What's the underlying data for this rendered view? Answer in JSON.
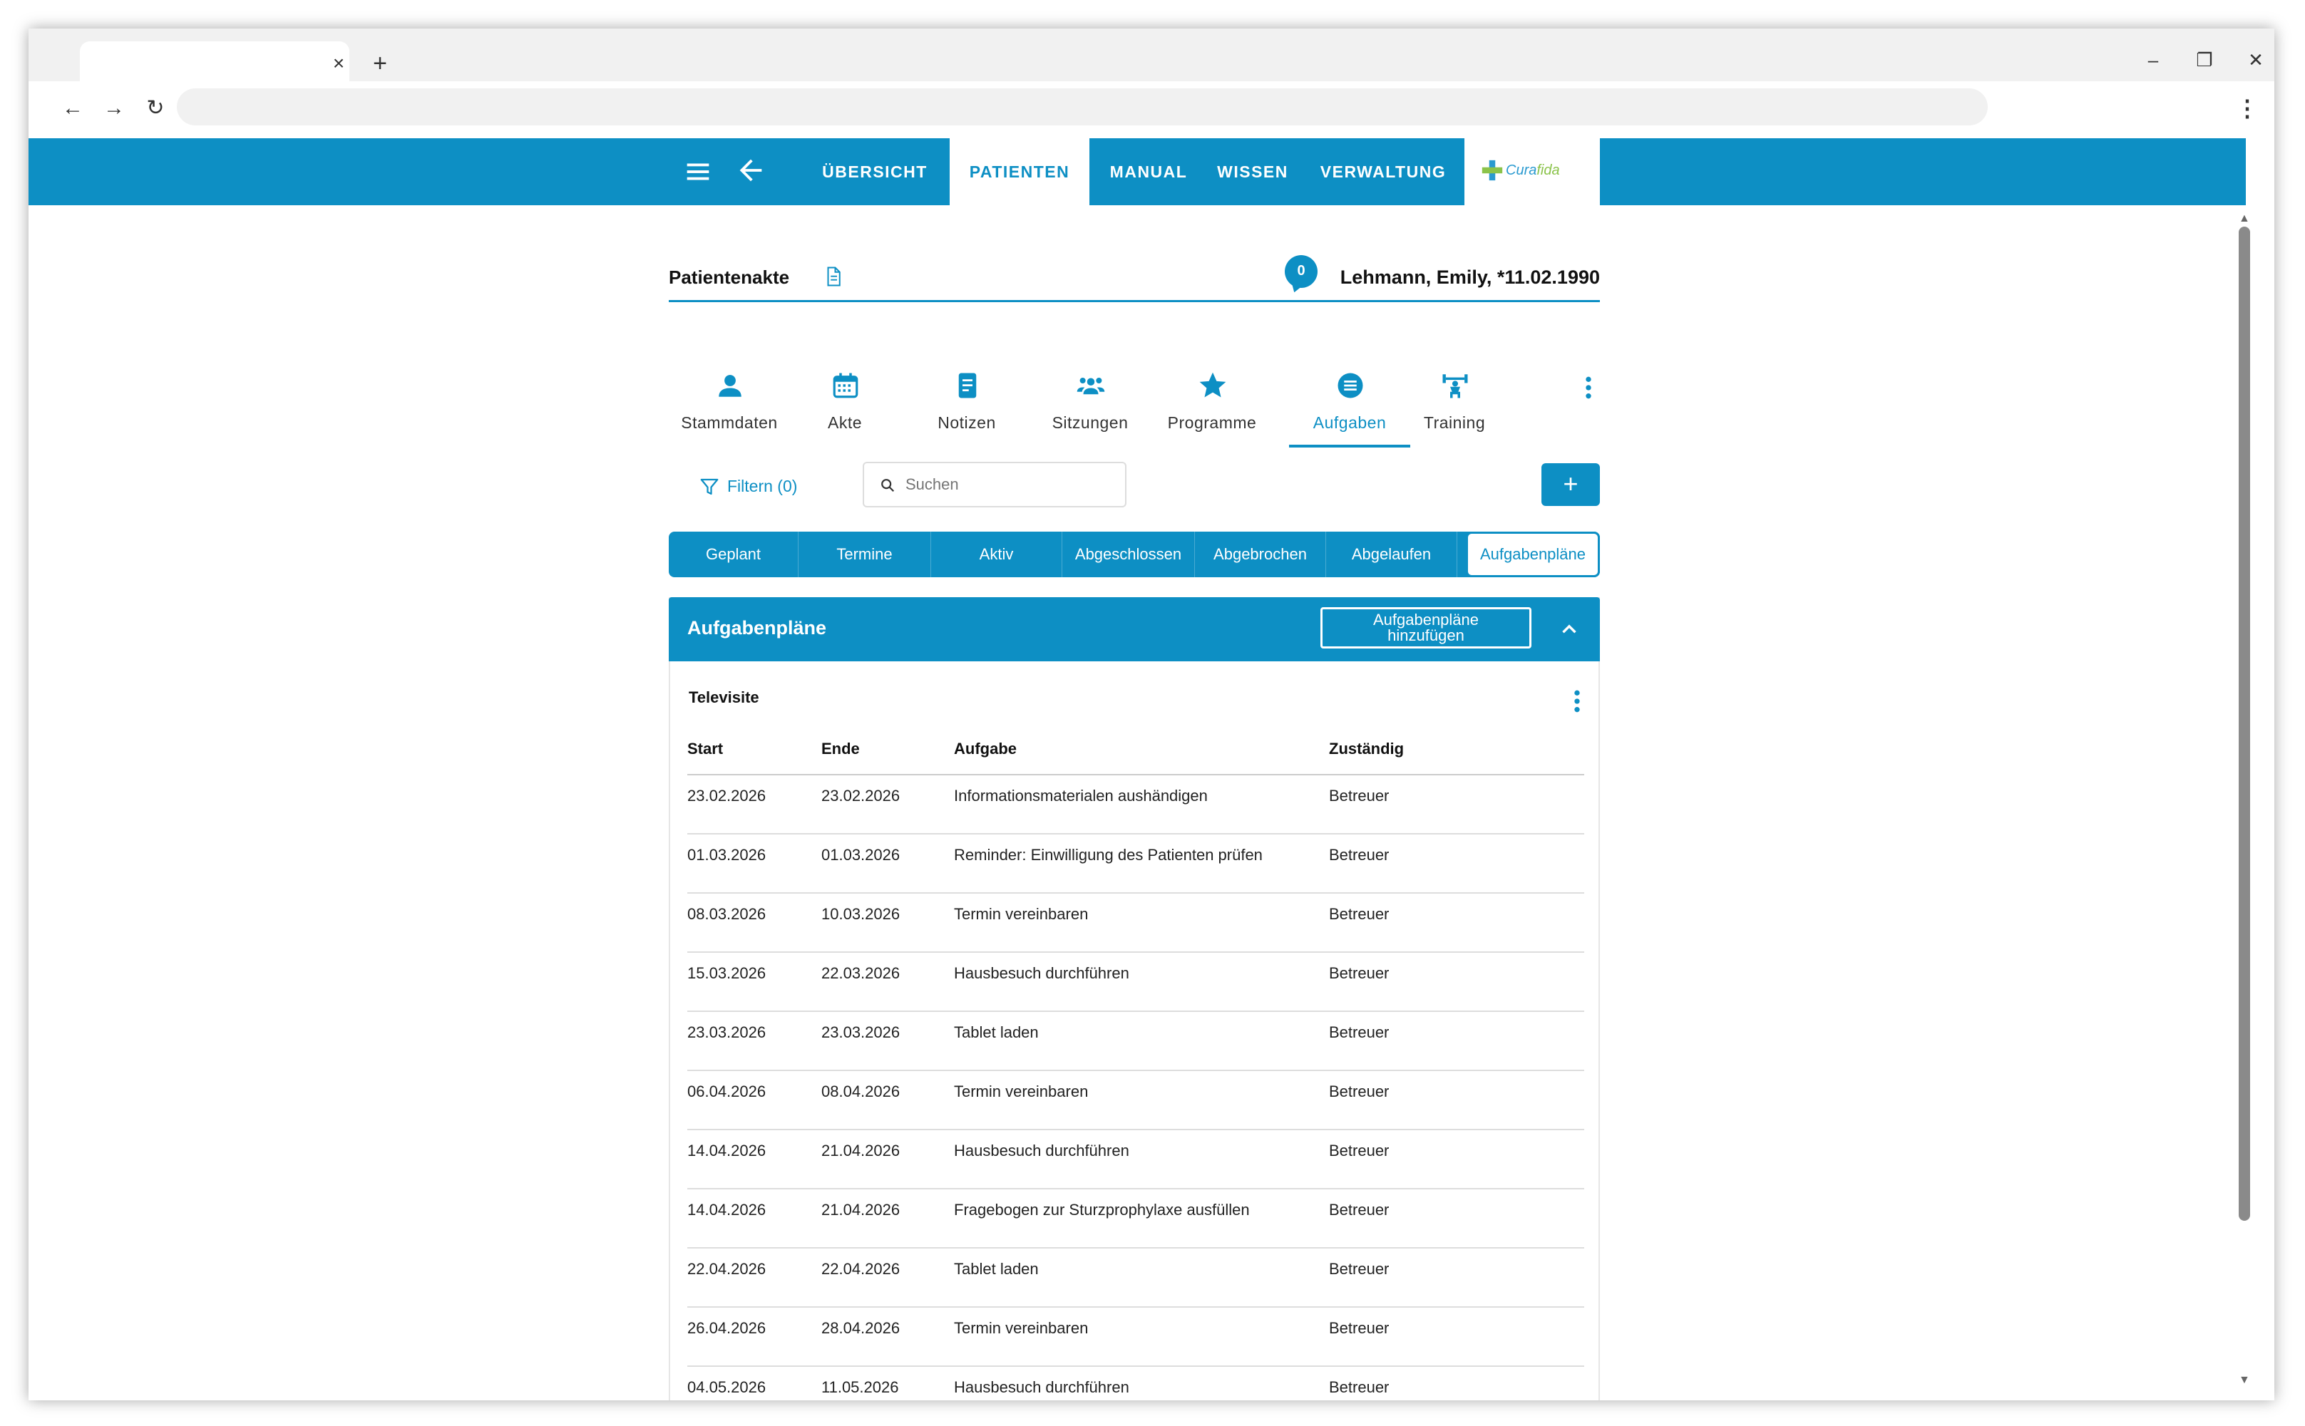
{
  "browser": {
    "tab_close": "×",
    "new_tab": "+",
    "minimize": "–",
    "restore": "❐",
    "close": "✕",
    "back": "←",
    "forward": "→",
    "reload": "↻",
    "menu": "⋮"
  },
  "header": {
    "nav": [
      "ÜBERSICHT",
      "PATIENTEN",
      "MANUAL",
      "WISSEN",
      "VERWALTUNG"
    ],
    "active_nav": "PATIENTEN",
    "logo": {
      "part1": "Cura",
      "part2": "fida"
    }
  },
  "record": {
    "title": "Patientenakte",
    "messages_count": "0",
    "patient": "Lehmann, Emily, *11.02.1990"
  },
  "icon_tabs": [
    "Stammdaten",
    "Akte",
    "Notizen",
    "Sitzungen",
    "Programme",
    "Aufgaben",
    "Training"
  ],
  "active_icon_tab": "Aufgaben",
  "toolbar": {
    "filter_label": "Filtern (0)",
    "search_placeholder": "Suchen",
    "add_label": "+"
  },
  "status_tabs": [
    "Geplant",
    "Termine",
    "Aktiv",
    "Abgeschlossen",
    "Abgebrochen",
    "Abgelaufen",
    "Aufgabenpläne"
  ],
  "active_status_tab": "Aufgabenpläne",
  "panel": {
    "title": "Aufgabenpläne",
    "add_label_line1": "Aufgabenpläne",
    "add_label_line2": "hinzufügen",
    "plan_name": "Televisite",
    "columns": [
      "Start",
      "Ende",
      "Aufgabe",
      "Zuständig"
    ],
    "rows": [
      [
        "23.02.2026",
        "23.02.2026",
        "Informationsmaterialen aushändigen",
        "Betreuer"
      ],
      [
        "01.03.2026",
        "01.03.2026",
        "Reminder: Einwilligung des Patienten prüfen",
        "Betreuer"
      ],
      [
        "08.03.2026",
        "10.03.2026",
        "Termin vereinbaren",
        "Betreuer"
      ],
      [
        "15.03.2026",
        "22.03.2026",
        "Hausbesuch durchführen",
        "Betreuer"
      ],
      [
        "23.03.2026",
        "23.03.2026",
        "Tablet laden",
        "Betreuer"
      ],
      [
        "06.04.2026",
        "08.04.2026",
        "Termin vereinbaren",
        "Betreuer"
      ],
      [
        "14.04.2026",
        "21.04.2026",
        "Hausbesuch durchführen",
        "Betreuer"
      ],
      [
        "14.04.2026",
        "21.04.2026",
        "Fragebogen zur Sturzprophylaxe ausfüllen",
        "Betreuer"
      ],
      [
        "22.04.2026",
        "22.04.2026",
        "Tablet laden",
        "Betreuer"
      ],
      [
        "26.04.2026",
        "28.04.2026",
        "Termin vereinbaren",
        "Betreuer"
      ],
      [
        "04.05.2026",
        "11.05.2026",
        "Hausbesuch durchführen",
        "Betreuer"
      ]
    ]
  },
  "colors": {
    "accent": "#0d8fc4",
    "logo_green": "#8bc34a"
  }
}
